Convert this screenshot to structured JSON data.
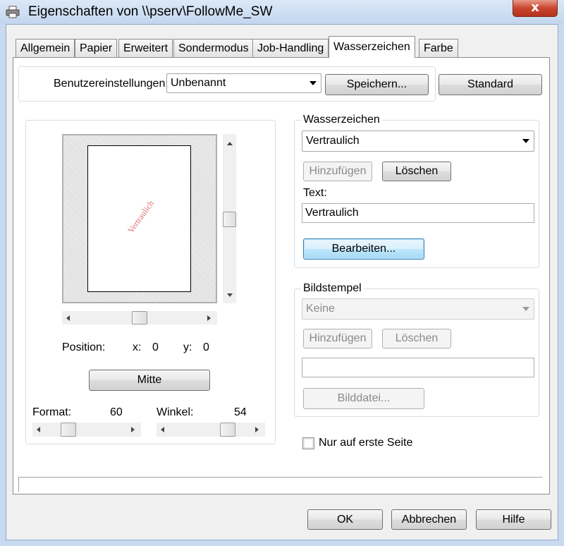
{
  "window": {
    "title": "Eigenschaften von \\\\pserv\\FollowMe_SW",
    "close_glyph": "x"
  },
  "tabs": [
    {
      "label": "Allgemein"
    },
    {
      "label": "Papier"
    },
    {
      "label": "Erweitert"
    },
    {
      "label": "Sondermodus"
    },
    {
      "label": "Job-Handling"
    },
    {
      "label": "Wasserzeichen",
      "active": true
    },
    {
      "label": "Farbe"
    }
  ],
  "settings": {
    "label": "Benutzereinstellungen:",
    "value": "Unbenannt",
    "save_button": "Speichern...",
    "default_button": "Standard"
  },
  "preview": {
    "watermark_text": "Vertraulich",
    "watermark_color": "#e07070",
    "position_label": "Position:",
    "x_label": "x:",
    "x_value": "0",
    "y_label": "y:",
    "y_value": "0",
    "center_button": "Mitte",
    "format_label": "Format:",
    "format_value": "60",
    "angle_label": "Winkel:",
    "angle_value": "54"
  },
  "watermark_group": {
    "legend": "Wasserzeichen",
    "selected": "Vertraulich",
    "add_button": "Hinzufügen",
    "delete_button": "Löschen",
    "text_label": "Text:",
    "text_value": "Vertraulich",
    "edit_button": "Bearbeiten..."
  },
  "stamp_group": {
    "legend": "Bildstempel",
    "selected": "Keine",
    "add_button": "Hinzufügen",
    "delete_button": "Löschen",
    "file_value": "",
    "file_button": "Bilddatei..."
  },
  "first_page_only": {
    "label": "Nur auf erste Seite",
    "checked": false
  },
  "footer": {
    "ok": "OK",
    "cancel": "Abbrechen",
    "help": "Hilfe"
  }
}
